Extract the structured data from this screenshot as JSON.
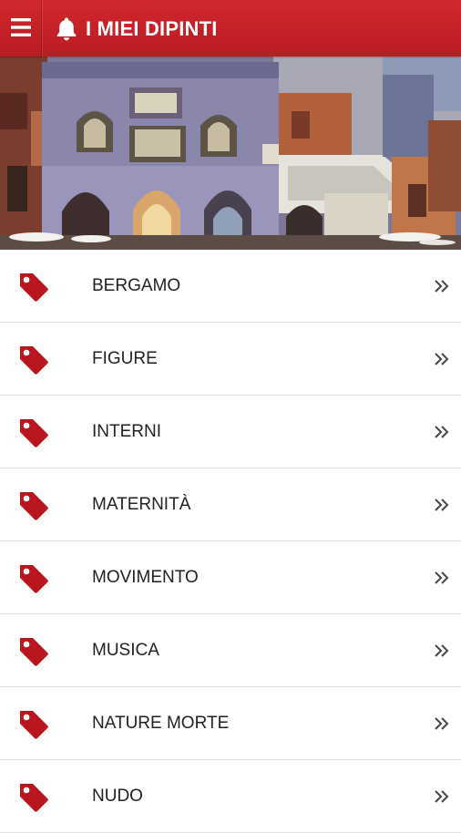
{
  "app": {
    "title": "I MIEI DIPINTI",
    "menu_icon": "hamburger-icon",
    "notification_icon": "bell-icon",
    "accent_color": "#c62128"
  },
  "banner": {
    "description_icon": "painting-banner"
  },
  "categories": [
    {
      "label": "BERGAMO",
      "icon": "tag-icon",
      "action_icon": "double-chevron-right-icon"
    },
    {
      "label": "FIGURE",
      "icon": "tag-icon",
      "action_icon": "double-chevron-right-icon"
    },
    {
      "label": "INTERNI",
      "icon": "tag-icon",
      "action_icon": "double-chevron-right-icon"
    },
    {
      "label": "MATERNITÀ",
      "icon": "tag-icon",
      "action_icon": "double-chevron-right-icon"
    },
    {
      "label": "MOVIMENTO",
      "icon": "tag-icon",
      "action_icon": "double-chevron-right-icon"
    },
    {
      "label": "MUSICA",
      "icon": "tag-icon",
      "action_icon": "double-chevron-right-icon"
    },
    {
      "label": "NATURE MORTE",
      "icon": "tag-icon",
      "action_icon": "double-chevron-right-icon"
    },
    {
      "label": "NUDO",
      "icon": "tag-icon",
      "action_icon": "double-chevron-right-icon"
    }
  ]
}
